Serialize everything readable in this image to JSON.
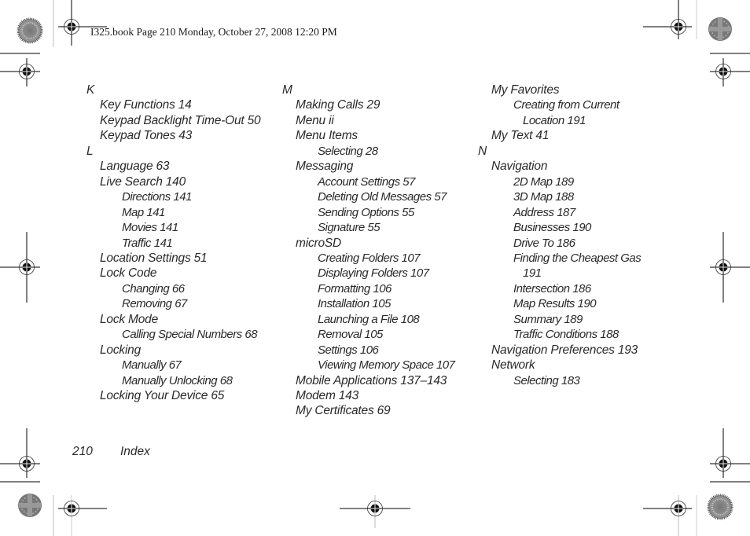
{
  "header": {
    "slug": "I325.book  Page 210  Monday, October 27, 2008  12:20 PM"
  },
  "footer": {
    "page_number": "210",
    "section": "Index"
  },
  "columns": [
    {
      "entries": [
        {
          "text": "K",
          "level": "letter"
        },
        {
          "text": "Key Functions 14",
          "level": 1
        },
        {
          "text": "Keypad Backlight Time-Out 50",
          "level": 1
        },
        {
          "text": "Keypad Tones 43",
          "level": 1
        },
        {
          "text": "L",
          "level": "letter"
        },
        {
          "text": "Language 63",
          "level": 1
        },
        {
          "text": "Live Search 140",
          "level": 1
        },
        {
          "text": "Directions 141",
          "level": 2
        },
        {
          "text": "Map 141",
          "level": 2
        },
        {
          "text": "Movies 141",
          "level": 2
        },
        {
          "text": "Traffic 141",
          "level": 2
        },
        {
          "text": "Location Settings 51",
          "level": 1
        },
        {
          "text": "Lock Code",
          "level": 1
        },
        {
          "text": "Changing 66",
          "level": 2
        },
        {
          "text": "Removing 67",
          "level": 2
        },
        {
          "text": "Lock Mode",
          "level": 1
        },
        {
          "text": "Calling Special Numbers 68",
          "level": 2
        },
        {
          "text": "Locking",
          "level": 1
        },
        {
          "text": "Manually 67",
          "level": 2
        },
        {
          "text": "Manually Unlocking 68",
          "level": 2
        },
        {
          "text": "Locking Your Device 65",
          "level": 1
        }
      ]
    },
    {
      "entries": [
        {
          "text": "M",
          "level": "letter"
        },
        {
          "text": "Making Calls 29",
          "level": 1
        },
        {
          "text": "Menu ii",
          "level": 1
        },
        {
          "text": "Menu Items",
          "level": 1
        },
        {
          "text": "Selecting 28",
          "level": 2
        },
        {
          "text": "Messaging",
          "level": 1
        },
        {
          "text": "Account Settings 57",
          "level": 2
        },
        {
          "text": "Deleting Old Messages 57",
          "level": 2
        },
        {
          "text": "Sending Options 55",
          "level": 2
        },
        {
          "text": "Signature 55",
          "level": 2
        },
        {
          "text": "microSD",
          "level": 1
        },
        {
          "text": "Creating Folders 107",
          "level": 2
        },
        {
          "text": "Displaying Folders 107",
          "level": 2
        },
        {
          "text": "Formatting 106",
          "level": 2
        },
        {
          "text": "Installation 105",
          "level": 2
        },
        {
          "text": "Launching a File 108",
          "level": 2
        },
        {
          "text": "Removal 105",
          "level": 2
        },
        {
          "text": "Settings 106",
          "level": 2
        },
        {
          "text": "Viewing Memory Space 107",
          "level": 2
        },
        {
          "text": "Mobile Applications 137–143",
          "level": 1
        },
        {
          "text": "Modem 143",
          "level": 1
        },
        {
          "text": "My Certificates 69",
          "level": 1
        }
      ]
    },
    {
      "entries": [
        {
          "text": "My Favorites",
          "level": 1
        },
        {
          "text": "Creating from Current",
          "level": 2
        },
        {
          "text": "Location 191",
          "level": 3
        },
        {
          "text": "My Text 41",
          "level": 1
        },
        {
          "text": "N",
          "level": "letter"
        },
        {
          "text": "Navigation",
          "level": 1
        },
        {
          "text": "2D Map 189",
          "level": 2
        },
        {
          "text": "3D Map 188",
          "level": 2
        },
        {
          "text": "Address 187",
          "level": 2
        },
        {
          "text": "Businesses 190",
          "level": 2
        },
        {
          "text": "Drive To 186",
          "level": 2
        },
        {
          "text": "Finding the Cheapest Gas",
          "level": 2
        },
        {
          "text": "191",
          "level": 3
        },
        {
          "text": "Intersection 186",
          "level": 2
        },
        {
          "text": "Map Results 190",
          "level": 2
        },
        {
          "text": "Summary 189",
          "level": 2
        },
        {
          "text": "Traffic Conditions 188",
          "level": 2
        },
        {
          "text": "Navigation Preferences 193",
          "level": 1
        },
        {
          "text": "Network",
          "level": 1
        },
        {
          "text": "Selecting 183",
          "level": 2
        }
      ]
    }
  ]
}
